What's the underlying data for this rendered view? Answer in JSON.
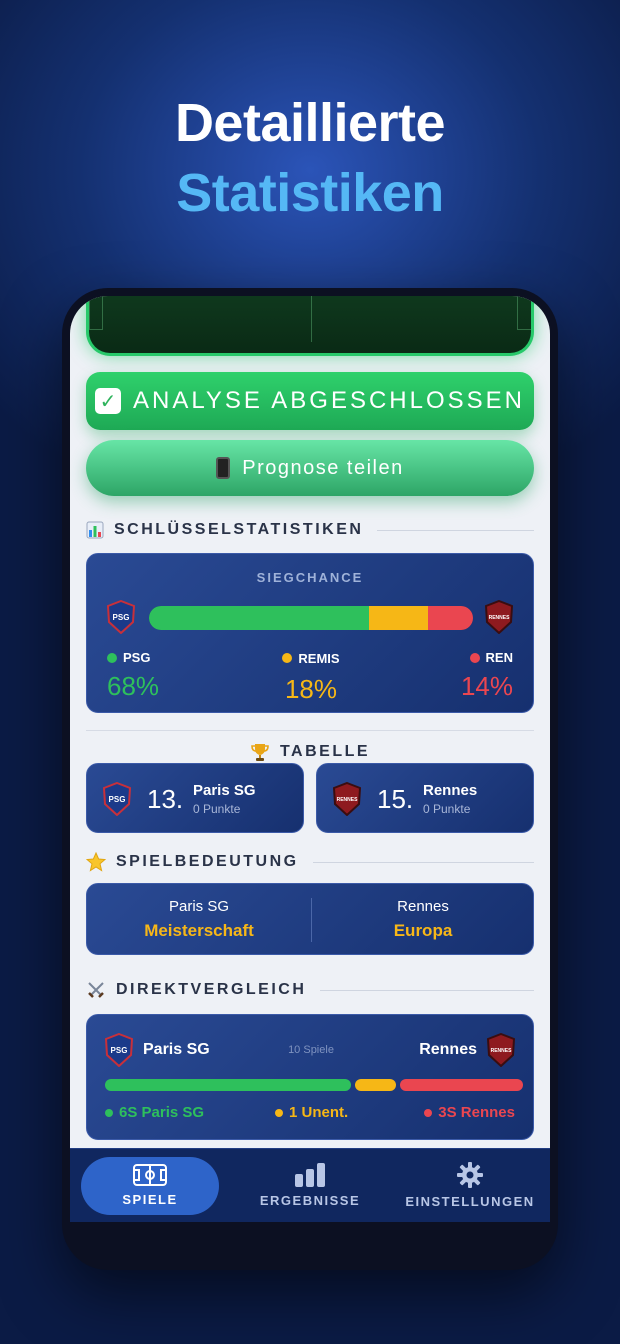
{
  "hero": {
    "line1": "Detaillierte",
    "line2": "Statistiken"
  },
  "actions": {
    "done_label": "ANALYSE ABGESCHLOSSEN",
    "share_label": "Prognose teilen"
  },
  "key_stats": {
    "title": "SCHLÜSSELSTATISTIKEN",
    "win_chance": {
      "label": "SIEGCHANCE",
      "home": {
        "badge": "PSG",
        "label": "PSG",
        "value": "68%",
        "pct": 68,
        "color": "#2ec05c"
      },
      "draw": {
        "label": "REMIS",
        "value": "18%",
        "pct": 18,
        "color": "#f6b716"
      },
      "away": {
        "badge": "RENNES",
        "label": "REN",
        "value": "14%",
        "pct": 14,
        "color": "#ea4650"
      }
    }
  },
  "table": {
    "title": "TABELLE",
    "home": {
      "badge": "PSG",
      "rank": "13.",
      "team": "Paris SG",
      "points": "0 Punkte"
    },
    "away": {
      "badge": "RENNES",
      "rank": "15.",
      "team": "Rennes",
      "points": "0 Punkte"
    }
  },
  "importance": {
    "title": "SPIELBEDEUTUNG",
    "home": {
      "team": "Paris SG",
      "goal": "Meisterschaft"
    },
    "away": {
      "team": "Rennes",
      "goal": "Europa"
    }
  },
  "h2h": {
    "title": "DIREKTVERGLEICH",
    "home_team": "Paris SG",
    "away_team": "Rennes",
    "home_badge": "PSG",
    "away_badge": "RENNES",
    "games": "10 Spiele",
    "home_wins": "6S Paris SG",
    "draws": "1 Unent.",
    "away_wins": "3S Rennes",
    "home_n": 6,
    "draw_n": 1,
    "away_n": 3
  },
  "nav": {
    "games": "SPIELE",
    "results": "ERGEBNISSE",
    "settings": "EINSTELLUNGEN"
  },
  "colors": {
    "green": "#2ec05c",
    "yellow": "#f6b716",
    "red": "#ea4650",
    "gold": "#f7b718",
    "card": "#1f3d84"
  }
}
